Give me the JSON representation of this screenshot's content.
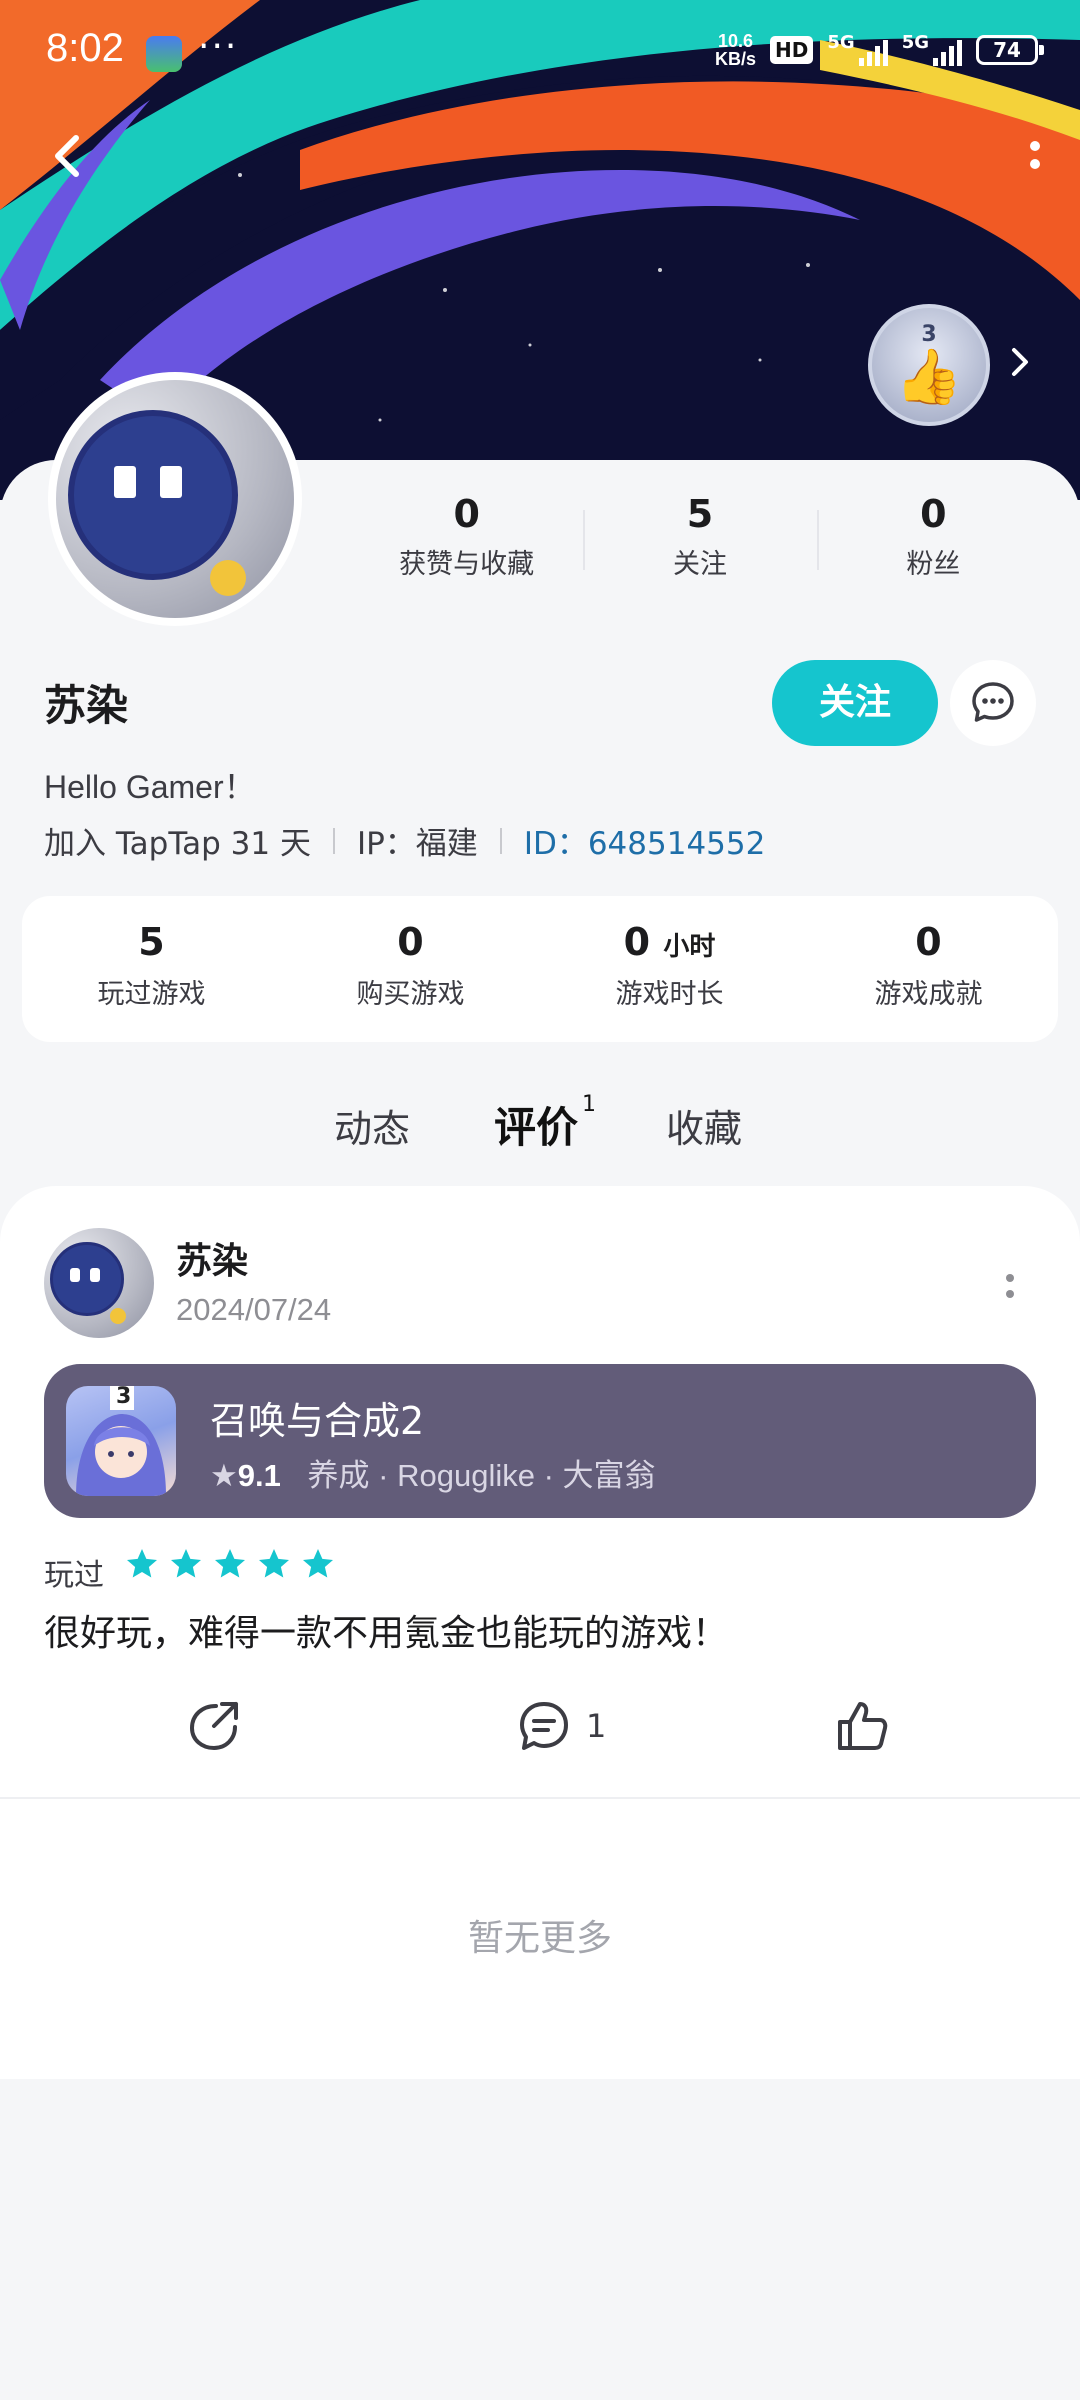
{
  "status_bar": {
    "time": "8:02",
    "speed_value": "10.6",
    "speed_unit": "KB/s",
    "hd_label": "HD",
    "network_1": "5G",
    "network_2": "5G",
    "battery": "74"
  },
  "header": {
    "back_icon": "chevron-left-icon",
    "more_icon": "more-vertical-icon",
    "badge_count": "3"
  },
  "profile": {
    "stats": [
      {
        "value": "0",
        "label": "获赞与收藏"
      },
      {
        "value": "5",
        "label": "关注"
      },
      {
        "value": "0",
        "label": "粉丝"
      }
    ],
    "username": "苏染",
    "follow_label": "关注",
    "bio": "Hello Gamer！",
    "joined": "加入 TapTap 31 天",
    "ip": "IP：福建",
    "id": "ID：648514552"
  },
  "game_stats": [
    {
      "value": "5",
      "unit": "",
      "label": "玩过游戏"
    },
    {
      "value": "0",
      "unit": "",
      "label": "购买游戏"
    },
    {
      "value": "0",
      "unit": "小时",
      "label": "游戏时长"
    },
    {
      "value": "0",
      "unit": "",
      "label": "游戏成就"
    }
  ],
  "tabs": [
    {
      "label": "动态",
      "active": false
    },
    {
      "label": "评价",
      "active": true,
      "count": "1"
    },
    {
      "label": "收藏",
      "active": false
    }
  ],
  "review": {
    "author": "苏染",
    "date": "2024/07/24",
    "game": {
      "title": "召唤与合成2",
      "rating": "9.1",
      "tags": [
        "养成",
        "Roguglike",
        "大富翁"
      ],
      "icon_badge": "3"
    },
    "played_label": "玩过",
    "stars": 5,
    "star_color": "#15c5ce",
    "text": "很好玩，难得一款不用氪金也能玩的游戏！",
    "comment_count": "1"
  },
  "footer": {
    "no_more": "暂无更多"
  },
  "colors": {
    "accent": "#15c5ce",
    "id_link": "#1e6ea8",
    "game_card_bg": "#625c79"
  }
}
